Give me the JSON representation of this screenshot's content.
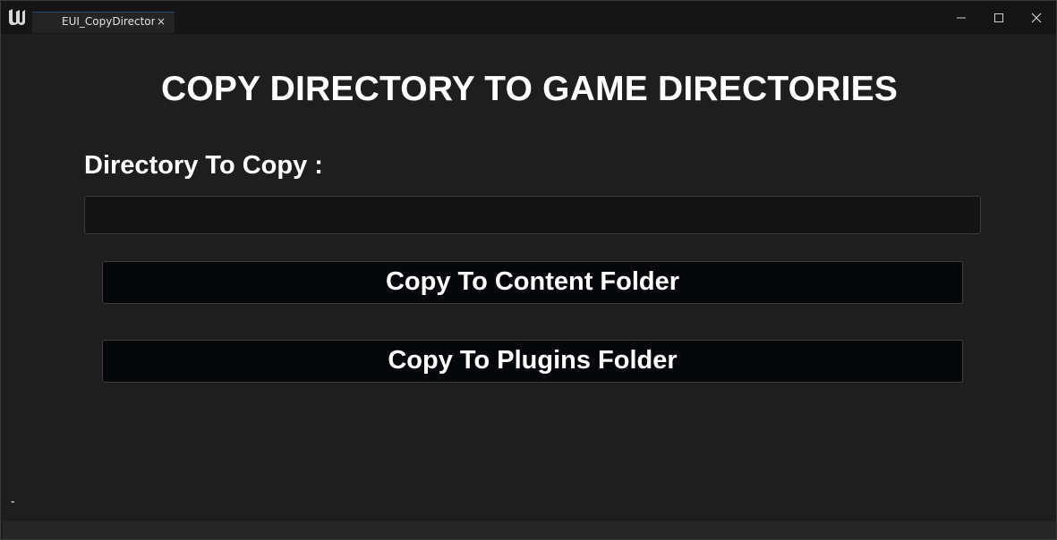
{
  "window": {
    "tab_title": "EUI_CopyDirector",
    "tab_close": "×"
  },
  "main": {
    "heading": "COPY DIRECTORY TO GAME DIRECTORIES",
    "directory_label": "Directory To Copy :",
    "directory_value": "",
    "copy_content_label": "Copy To Content Folder",
    "copy_plugins_label": "Copy To Plugins Folder",
    "footer_text": "-"
  },
  "colors": {
    "background": "#1e1e1e",
    "titlebar": "#151515",
    "button": "#05070a",
    "text": "#ffffff"
  },
  "icons": {
    "logo": "unreal-logo-icon",
    "minimize": "minimize-icon",
    "maximize": "maximize-icon",
    "close": "close-icon"
  }
}
